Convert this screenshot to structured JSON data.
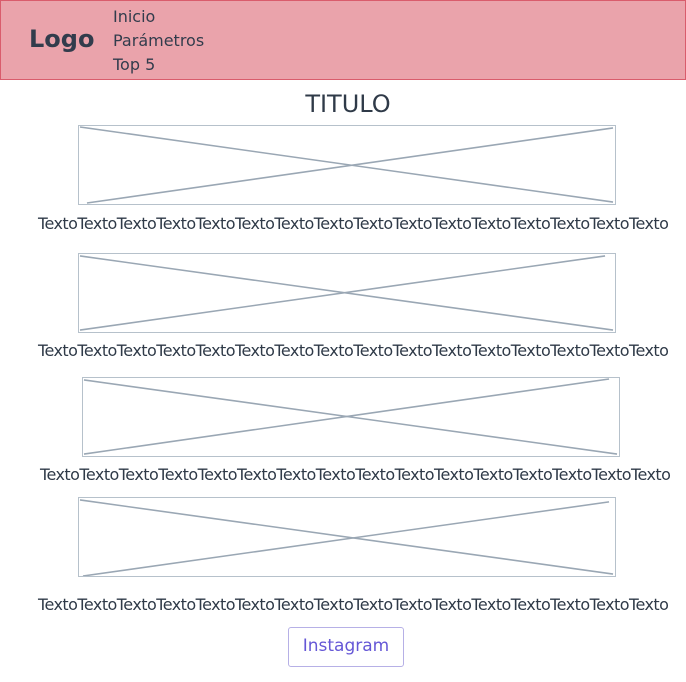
{
  "header": {
    "logo": "Logo",
    "nav": [
      "Inicio",
      "Parámetros",
      "Top 5"
    ]
  },
  "main": {
    "title": "TITULO",
    "sections": [
      {
        "caption": "TextoTextoTextoTextoTextoTextoTextoTextoTextoTextoTextoTextoTextoTextoTextoTexto"
      },
      {
        "caption": "TextoTextoTextoTextoTextoTextoTextoTextoTextoTextoTextoTextoTextoTextoTextoTexto"
      },
      {
        "caption": "TextoTextoTextoTextoTextoTextoTextoTextoTextoTextoTextoTextoTextoTextoTextoTexto"
      },
      {
        "caption": "TextoTextoTextoTextoTextoTextoTextoTextoTextoTextoTextoTextoTextoTextoTextoTexto"
      }
    ],
    "instagram_label": "Instagram"
  }
}
